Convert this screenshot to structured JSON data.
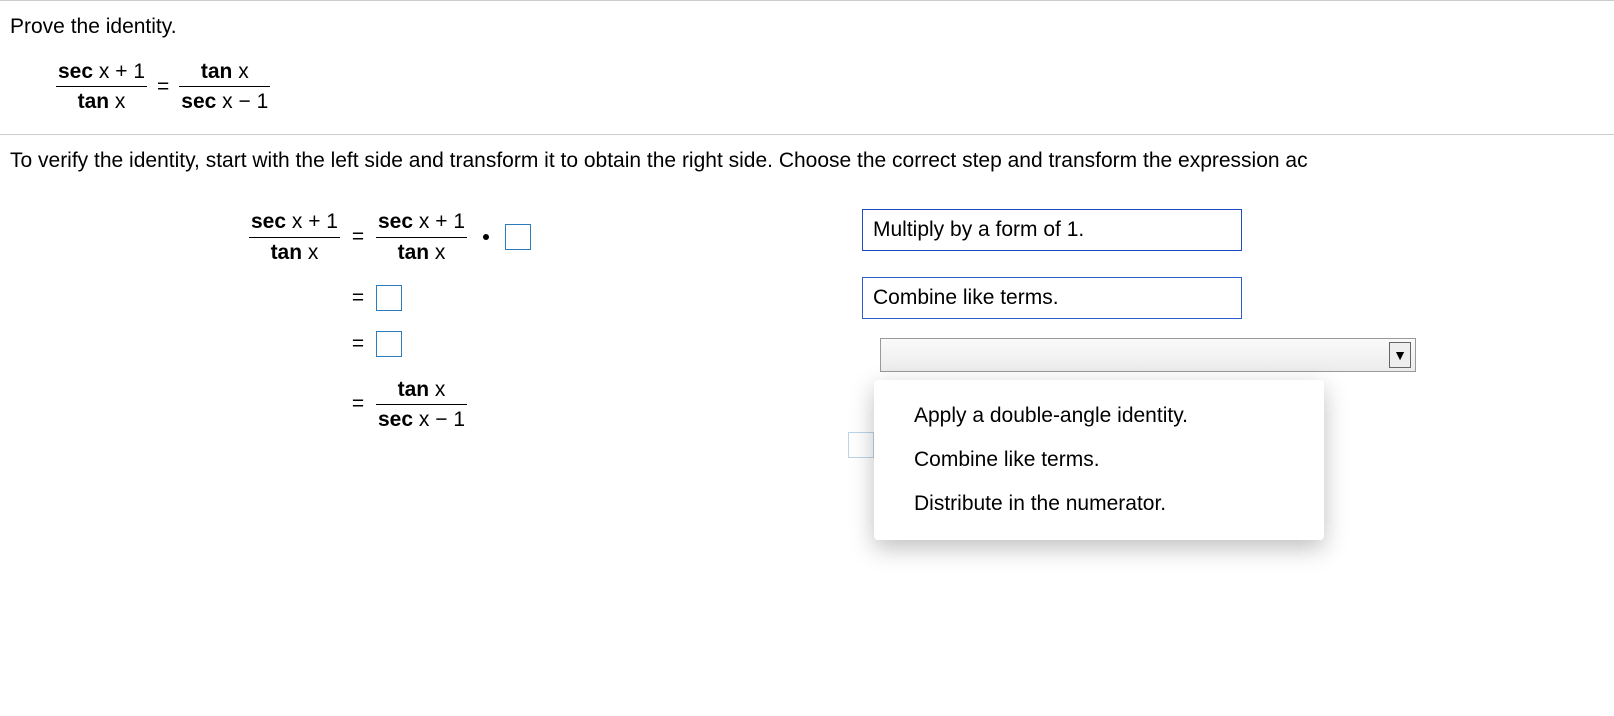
{
  "prompt": "Prove the identity.",
  "identity": {
    "left": {
      "num": {
        "fn": "sec",
        "var": "x",
        "tail": " + 1"
      },
      "den": {
        "fn": "tan",
        "var": "x",
        "tail": ""
      }
    },
    "right": {
      "num": {
        "fn": "tan",
        "var": "x",
        "tail": ""
      },
      "den": {
        "fn": "sec",
        "var": "x",
        "tail": " − 1"
      }
    }
  },
  "instruction": "To verify the identity, start with the left side and transform it to obtain the right side. Choose the correct step and transform the expression ac",
  "equals": "=",
  "steps": {
    "r1_left": {
      "num": {
        "fn": "sec",
        "var": "x",
        "tail": " + 1"
      },
      "den": {
        "fn": "tan",
        "var": "x",
        "tail": ""
      }
    },
    "r1_right": {
      "num": {
        "fn": "sec",
        "var": "x",
        "tail": " + 1"
      },
      "den": {
        "fn": "tan",
        "var": "x",
        "tail": ""
      }
    },
    "r4_right": {
      "num": {
        "fn": "tan",
        "var": "x",
        "tail": ""
      },
      "den": {
        "fn": "sec",
        "var": "x",
        "tail": " − 1"
      }
    }
  },
  "rules": {
    "r1": "Multiply by a form of 1.",
    "r2": "Combine like terms."
  },
  "dropdown": {
    "options": [
      "Apply a double-angle identity.",
      "Combine like terms.",
      "Distribute in the numerator."
    ]
  }
}
